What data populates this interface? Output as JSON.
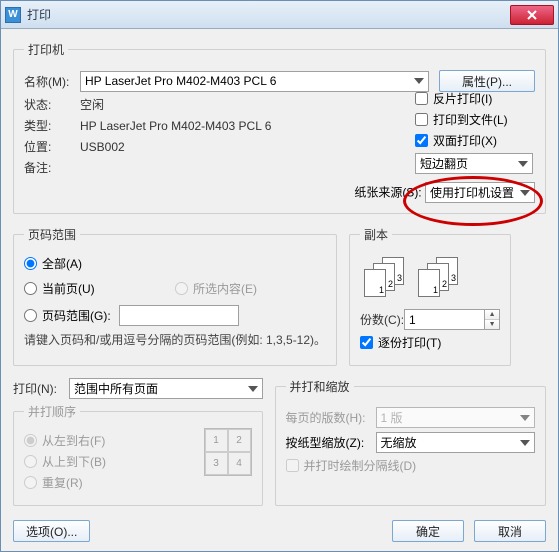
{
  "window": {
    "title": "打印"
  },
  "printer": {
    "group_label": "打印机",
    "name_label": "名称(M):",
    "name_value": "HP LaserJet Pro M402-M403 PCL 6",
    "properties_btn": "属性(P)...",
    "status_label": "状态:",
    "status_value": "空闲",
    "type_label": "类型:",
    "type_value": "HP LaserJet Pro M402-M403 PCL 6",
    "port_label": "位置:",
    "port_value": "USB002",
    "comment_label": "备注:",
    "comment_value": "",
    "reverse_label": "反片打印(I)",
    "tofile_label": "打印到文件(L)",
    "duplex_label": "双面打印(X)",
    "duplex_mode": "短边翻页",
    "paper_source_label": "纸张来源(S):",
    "paper_source_value": "使用打印机设置"
  },
  "range": {
    "group_label": "页码范围",
    "all": "全部(A)",
    "current": "当前页(U)",
    "selection": "所选内容(E)",
    "pages": "页码范围(G):",
    "hint": "请键入页码和/或用逗号分隔的页码范围(例如: 1,3,5-12)。"
  },
  "copies": {
    "group_label": "副本",
    "count_label": "份数(C):",
    "count_value": "1",
    "collate_label": "逐份打印(T)"
  },
  "printwhat": {
    "label": "打印(N):",
    "value": "范围中所有页面"
  },
  "order": {
    "group_label": "并打顺序",
    "ltr": "从左到右(F)",
    "ttb": "从上到下(B)",
    "repeat": "重复(R)"
  },
  "zoom": {
    "group_label": "并打和缩放",
    "pps_label": "每页的版数(H):",
    "pps_value": "1 版",
    "scale_label": "按纸型缩放(Z):",
    "scale_value": "无缩放",
    "divider_label": "并打时绘制分隔线(D)"
  },
  "footer": {
    "options": "选项(O)...",
    "ok": "确定",
    "cancel": "取消"
  }
}
